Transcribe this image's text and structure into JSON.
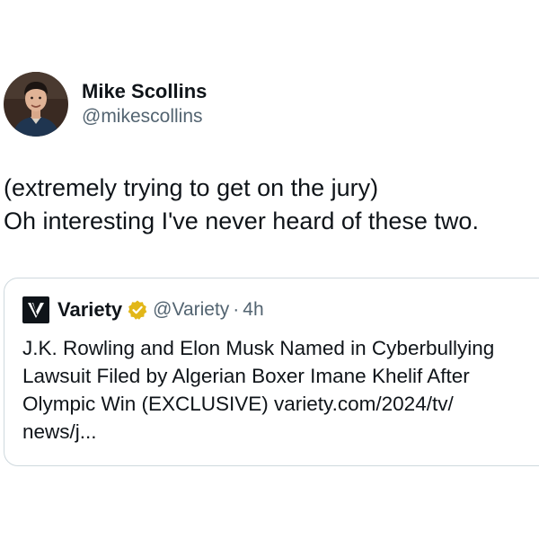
{
  "tweet": {
    "author": {
      "display_name": "Mike Scollins",
      "handle": "@mikescollins"
    },
    "text_lines": [
      "(extremely trying to get on the jury)",
      "Oh interesting I've never heard of these two."
    ],
    "quoted": {
      "logo_letter": "V",
      "display_name": "Variety",
      "handle": "@Variety",
      "separator": "·",
      "time": "4h",
      "verified_color": "#e2b719",
      "text_lines": [
        "J.K. Rowling and Elon Musk Named in Cyberbullying",
        "Lawsuit Filed by Algerian Boxer Imane Khelif After",
        "Olympic Win (EXCLUSIVE) variety.com/2024/tv/",
        "news/j..."
      ]
    }
  },
  "colors": {
    "text_primary": "#0f1419",
    "text_secondary": "#536471",
    "border": "#cfd9de",
    "verified_gold": "#e2b719"
  }
}
